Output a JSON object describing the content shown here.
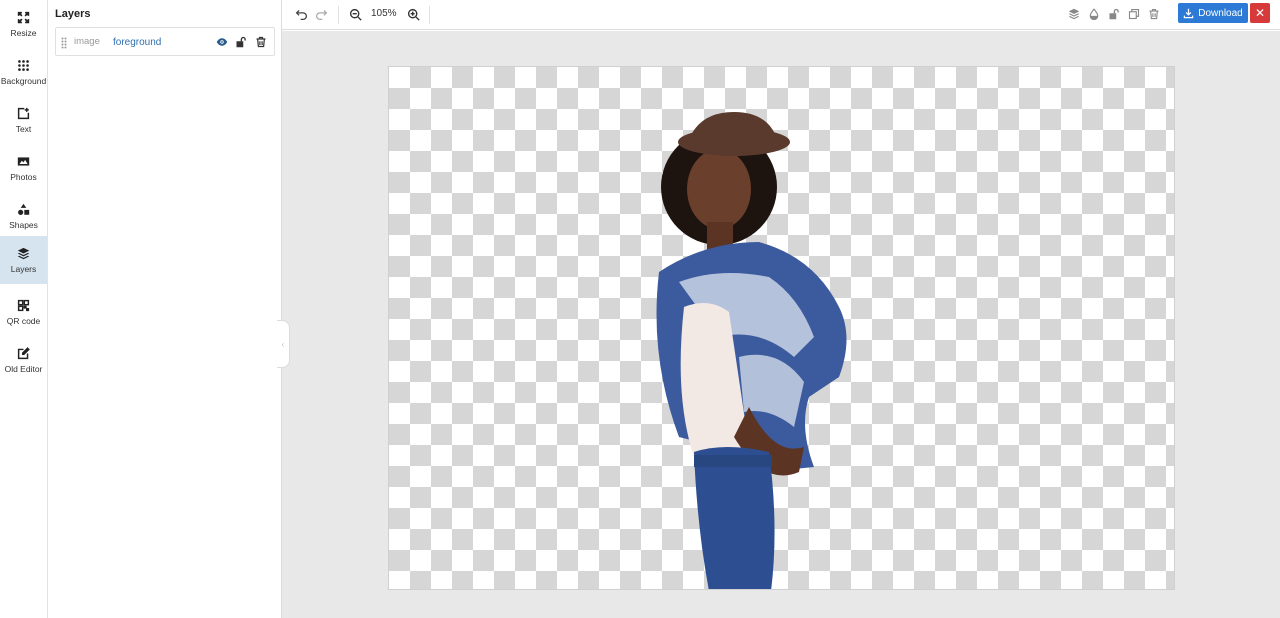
{
  "rail": {
    "items": [
      {
        "label": "Resize",
        "icon": "resize-icon"
      },
      {
        "label": "Background",
        "icon": "grid-dots-icon"
      },
      {
        "label": "Text",
        "icon": "text-add-icon"
      },
      {
        "label": "Photos",
        "icon": "image-icon"
      },
      {
        "label": "Shapes",
        "icon": "shapes-icon"
      },
      {
        "label": "Layers",
        "icon": "layers-icon",
        "active": true
      },
      {
        "label": "QR code",
        "icon": "qr-code-icon"
      },
      {
        "label": "Old Editor",
        "icon": "edit-icon"
      }
    ]
  },
  "panel": {
    "title": "Layers",
    "layers": [
      {
        "type": "image",
        "name": "foreground"
      }
    ]
  },
  "toolbar": {
    "zoom": "105%",
    "download_label": "Download",
    "close_label": "✕"
  },
  "colors": {
    "accent": "#2c7ad6",
    "danger": "#d63a3a",
    "active_rail": "#d5e4ef",
    "layer_name": "#2f6fb0"
  }
}
